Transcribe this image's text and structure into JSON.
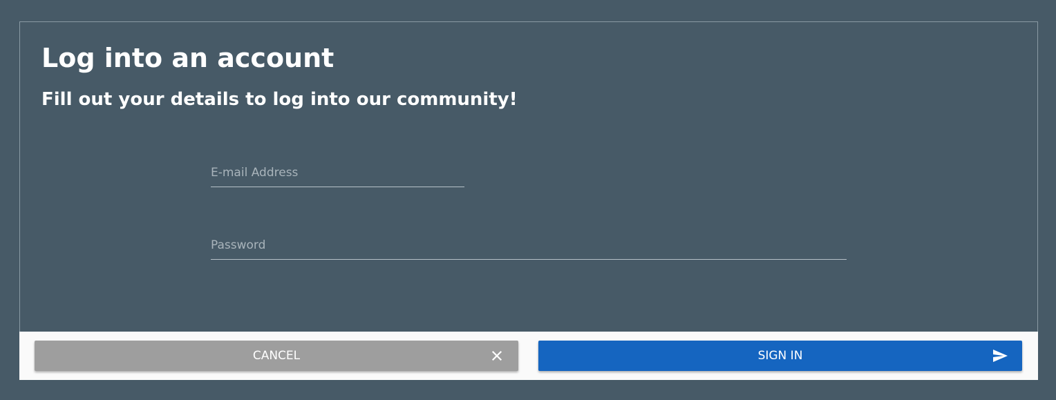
{
  "form": {
    "title": "Log into an account",
    "subtitle": "Fill out your details to log into our community!",
    "email": {
      "value": "",
      "placeholder": "E-mail Address"
    },
    "password": {
      "value": "",
      "placeholder": "Password"
    }
  },
  "actions": {
    "cancel_label": "CANCEL",
    "cancel_icon": "close-icon",
    "signin_label": "SIGN IN",
    "signin_icon": "send-icon"
  },
  "colors": {
    "background": "#475a67",
    "footer": "#fafafa",
    "cancel": "#9e9e9e",
    "primary": "#1565c0",
    "text": "#ffffff"
  }
}
